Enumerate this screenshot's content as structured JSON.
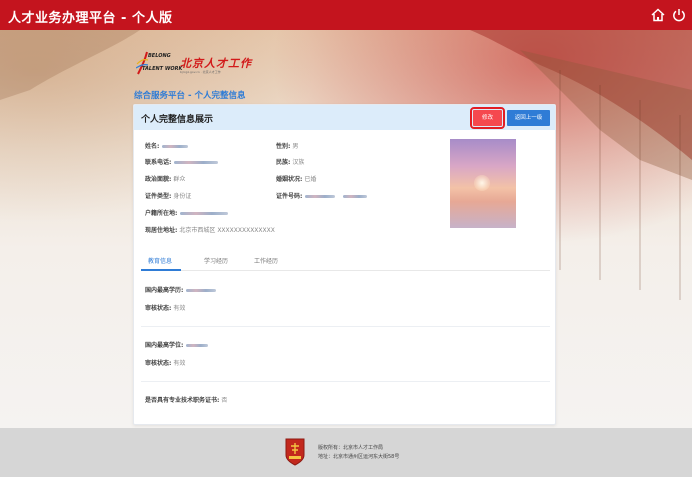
{
  "header": {
    "title": "人才业务办理平台 - 个人版",
    "home_icon": "home-icon",
    "power_icon": "power-icon"
  },
  "logo": {
    "english_top": "BELONG",
    "english_bottom": "TALENT WORK",
    "chinese": "北京人才工作",
    "url": "bjrcgz.gov.cn · 北京人才工作"
  },
  "breadcrumb": "综合服务平台 - 个人完整信息",
  "card": {
    "title": "个人完整信息展示",
    "edit_label": "修改",
    "back_label": "返回上一级",
    "fields": {
      "name_label": "姓名:",
      "gender_label": "性别:",
      "gender_value": "男",
      "phone_label": "联系电话:",
      "ethnicity_label": "民族:",
      "ethnicity_value": "汉族",
      "political_label": "政治面貌:",
      "political_value": "群众",
      "marital_label": "婚姻状况:",
      "marital_value": "已婚",
      "idtype_label": "证件类型:",
      "idtype_value": "身份证",
      "idnum_label": "证件号码:",
      "hukou_label": "户籍所在地:",
      "address_label": "现居住地址:",
      "address_value": "北京市西城区 XXXXXXXXXXXXXX"
    },
    "tabs": [
      "教育信息",
      "学习经历",
      "工作经历"
    ],
    "education": {
      "degree_label": "国内最高学历:",
      "degree_status_label": "审核状态:",
      "degree_status_value": "有效",
      "level_label": "国内最高学位:",
      "level_status_label": "审核状态:",
      "level_status_value": "有效",
      "cert_label": "是否具有专业技术职务证书:",
      "cert_value": "否"
    }
  },
  "footer": {
    "copyright": "版权所有：北京市人才工作局",
    "address": "地址：北京市通州区运河东大街58号"
  },
  "colors": {
    "header_red": "#c4141e",
    "accent_blue": "#2f7cd6",
    "edit_red": "#f5484f"
  }
}
